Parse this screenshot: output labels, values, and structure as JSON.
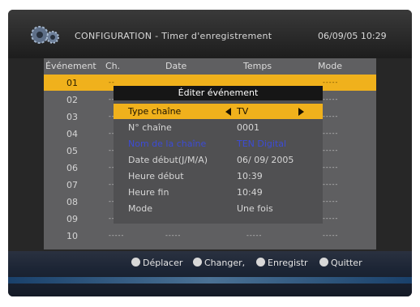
{
  "header": {
    "title": "CONFIGURATION - Timer d'enregistrement",
    "datetime": "06/09/05 10:29"
  },
  "table": {
    "columns": [
      "Événement",
      "Ch.",
      "Date",
      "Temps",
      "Mode"
    ],
    "rows": [
      {
        "num": "01",
        "ch": "--",
        "date": "",
        "time": "",
        "mode": "-----"
      },
      {
        "num": "02",
        "ch": "--",
        "date": "",
        "time": "",
        "mode": "-----"
      },
      {
        "num": "03",
        "ch": "--",
        "date": "",
        "time": "",
        "mode": "-----"
      },
      {
        "num": "04",
        "ch": "--",
        "date": "",
        "time": "",
        "mode": "-----"
      },
      {
        "num": "05",
        "ch": "--",
        "date": "",
        "time": "",
        "mode": "-----"
      },
      {
        "num": "06",
        "ch": "--",
        "date": "",
        "time": "",
        "mode": "-----"
      },
      {
        "num": "07",
        "ch": "--",
        "date": "",
        "time": "",
        "mode": "-----"
      },
      {
        "num": "08",
        "ch": "--",
        "date": "",
        "time": "",
        "mode": "-----"
      },
      {
        "num": "09",
        "ch": "-----",
        "date": "-----",
        "time": "-----",
        "mode": "-----"
      },
      {
        "num": "10",
        "ch": "-----",
        "date": "-----",
        "time": "-----",
        "mode": "-----"
      }
    ],
    "selected_row": "01"
  },
  "dialog": {
    "title": "Éditer événement",
    "fields": [
      {
        "label": "Type chaîne",
        "value": "TV"
      },
      {
        "label": "N° chaîne",
        "value": "0001"
      },
      {
        "label": "Nom de la chaîne",
        "value": "TEN Digital"
      },
      {
        "label": "Date début(J/M/A)",
        "value": "06/ 09/ 2005"
      },
      {
        "label": "Heure début",
        "value": "10:39"
      },
      {
        "label": "Heure fin",
        "value": "10:49"
      },
      {
        "label": "Mode",
        "value": "Une fois"
      }
    ]
  },
  "footer": {
    "move": "Déplacer",
    "change": "Changer,",
    "save": "Enregistr",
    "quit": "Quitter"
  },
  "colors": {
    "highlight": "#f0b11c",
    "channel_name": "#3c4bd6"
  }
}
